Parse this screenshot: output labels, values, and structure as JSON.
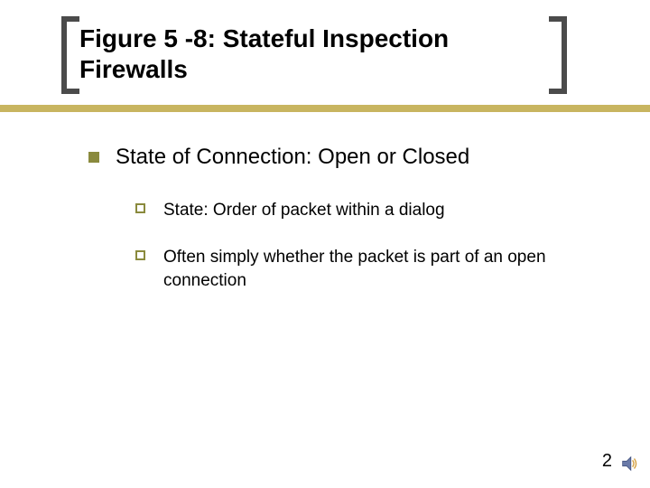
{
  "title": "Figure 5 -8: Stateful Inspection Firewalls",
  "body": {
    "level1": "State of Connection: Open or Closed",
    "level2": [
      "State: Order of packet within a dialog",
      "Often simply whether the packet is part of an open connection"
    ]
  },
  "page_number": "2",
  "icons": {
    "sound": "sound-icon"
  },
  "colors": {
    "accent_bar": "#c8b560",
    "bullet": "#8a8a3d",
    "bracket": "#4b4b4b"
  }
}
